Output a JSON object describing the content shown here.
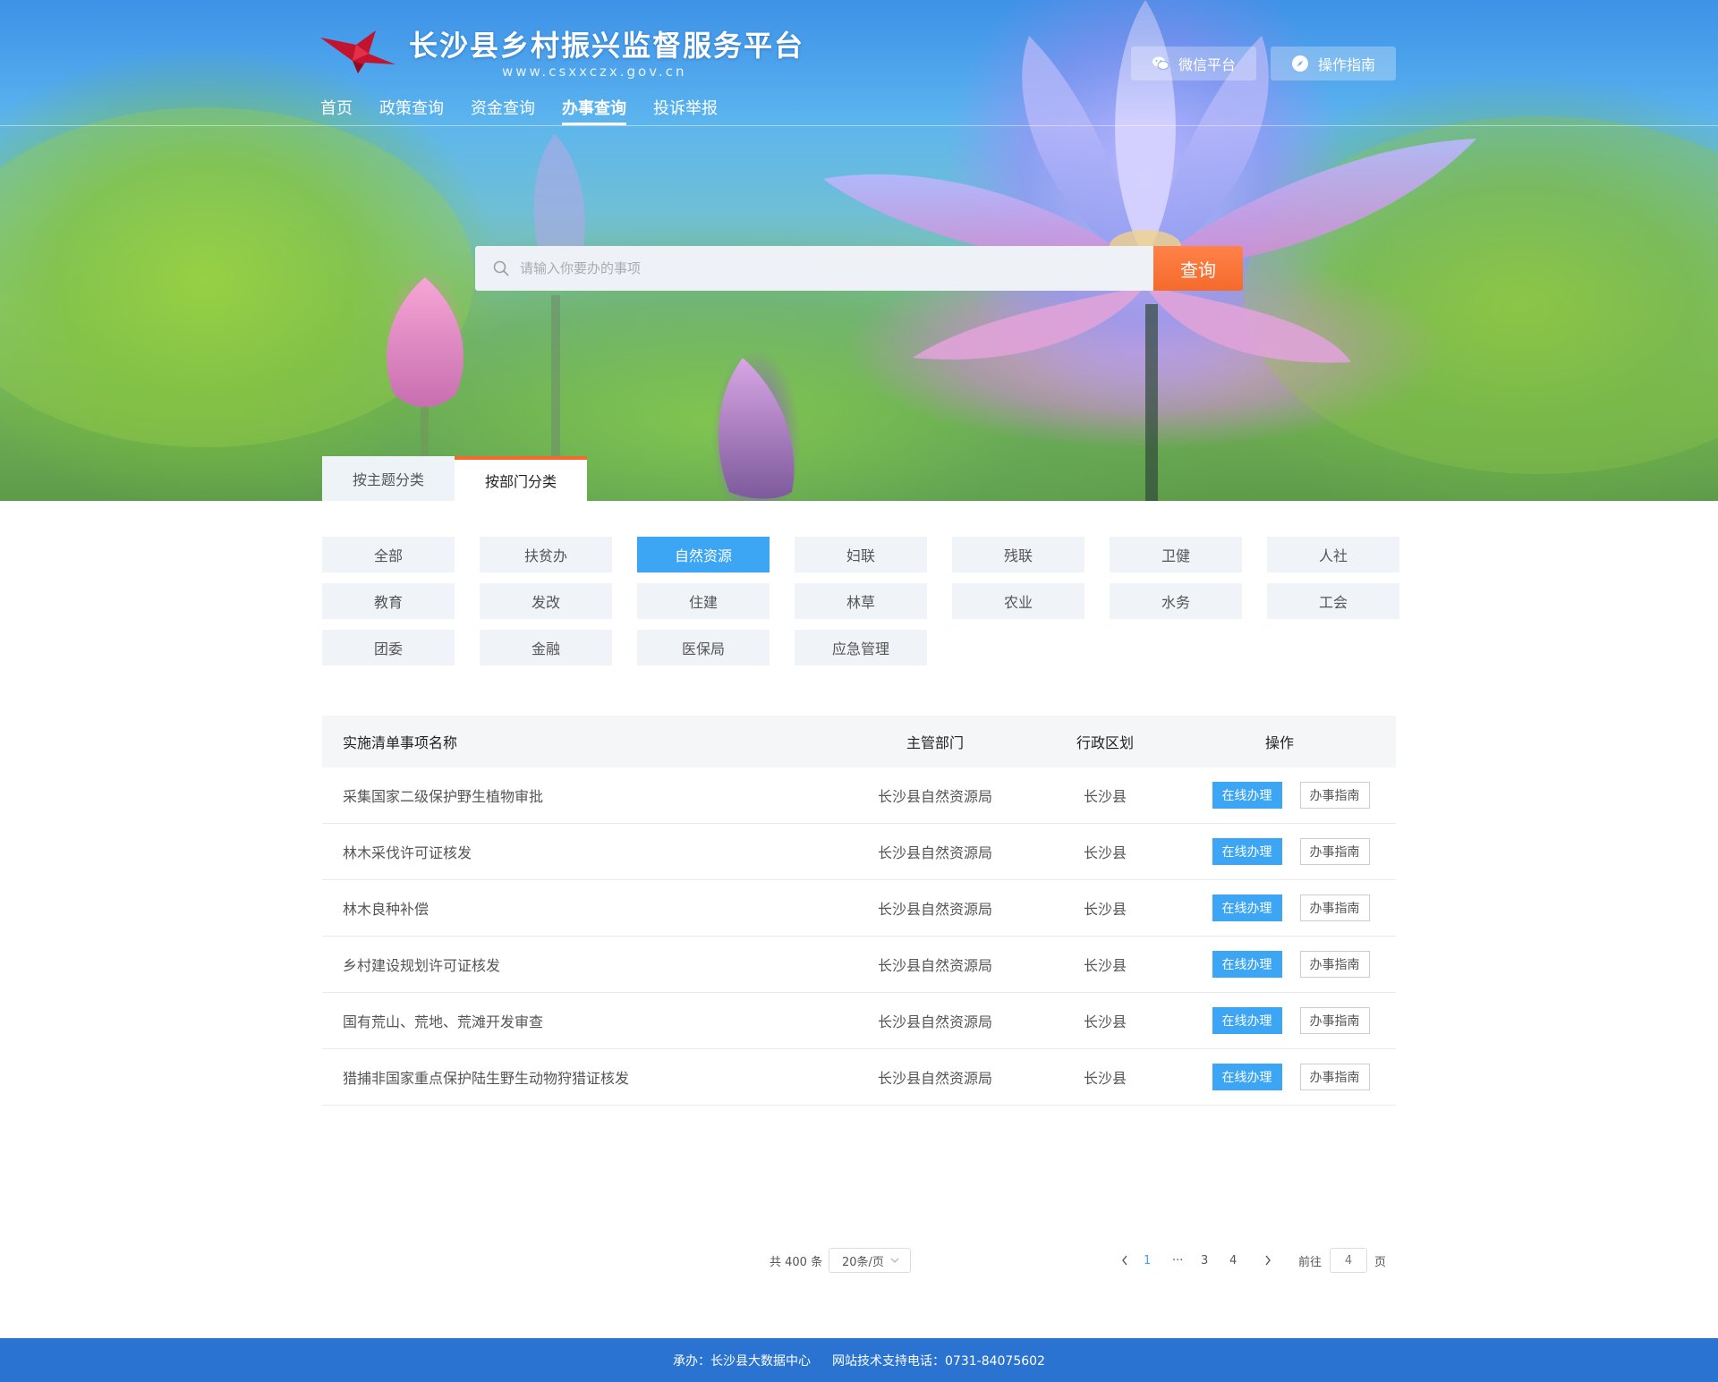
{
  "header": {
    "site_title": "长沙县乡村振兴监督服务平台",
    "site_url": "www.csxxczx.gov.cn",
    "nav": [
      {
        "label": "首页"
      },
      {
        "label": "政策查询"
      },
      {
        "label": "资金查询"
      },
      {
        "label": "办事查询",
        "active": true
      },
      {
        "label": "投诉举报"
      }
    ],
    "wechat_label": "微信平台",
    "guide_label": "操作指南"
  },
  "search": {
    "placeholder": "请输入你要办的事项",
    "value": "",
    "button_label": "查询"
  },
  "category_tabs": [
    {
      "label": "按主题分类"
    },
    {
      "label": "按部门分类",
      "active": true
    }
  ],
  "departments": [
    {
      "label": "全部"
    },
    {
      "label": "扶贫办"
    },
    {
      "label": "自然资源",
      "active": true
    },
    {
      "label": "妇联"
    },
    {
      "label": "残联"
    },
    {
      "label": "卫健"
    },
    {
      "label": "人社"
    },
    {
      "label": "教育"
    },
    {
      "label": "发改"
    },
    {
      "label": "住建"
    },
    {
      "label": "林草"
    },
    {
      "label": "农业"
    },
    {
      "label": "水务"
    },
    {
      "label": "工会"
    },
    {
      "label": "团委"
    },
    {
      "label": "金融"
    },
    {
      "label": "医保局"
    },
    {
      "label": "应急管理"
    }
  ],
  "table": {
    "headers": {
      "name": "实施清单事项名称",
      "dept": "主管部门",
      "region": "行政区划",
      "ops": "操作"
    },
    "online_label": "在线办理",
    "guide_label": "办事指南",
    "rows": [
      {
        "name": "采集国家二级保护野生植物审批",
        "dept": "长沙县自然资源局",
        "region": "长沙县"
      },
      {
        "name": "林木采伐许可证核发",
        "dept": "长沙县自然资源局",
        "region": "长沙县"
      },
      {
        "name": "林木良种补偿",
        "dept": "长沙县自然资源局",
        "region": "长沙县"
      },
      {
        "name": "乡村建设规划许可证核发",
        "dept": "长沙县自然资源局",
        "region": "长沙县"
      },
      {
        "name": "国有荒山、荒地、荒滩开发审查",
        "dept": "长沙县自然资源局",
        "region": "长沙县"
      },
      {
        "name": "猎捕非国家重点保护陆生野生动物狩猎证核发",
        "dept": "长沙县自然资源局",
        "region": "长沙县"
      }
    ]
  },
  "pagination": {
    "total": "共 400 条",
    "page_size": "20条/页",
    "pages": [
      "1",
      "···",
      "3",
      "4"
    ],
    "current": "1",
    "goto_label": "前往",
    "goto_value": "4",
    "goto_unit": "页"
  },
  "footer": {
    "organizer": "承办：长沙县大数据中心",
    "support": "网站技术支持电话：0731-84075602"
  },
  "colors": {
    "accent_blue": "#3ca5f4",
    "accent_orange": "#f56a2c",
    "footer_blue": "#2a73d0"
  },
  "icons": {
    "logo": "star-logo-icon",
    "wechat": "wechat-icon",
    "guide": "compass-icon",
    "search": "search-icon"
  }
}
